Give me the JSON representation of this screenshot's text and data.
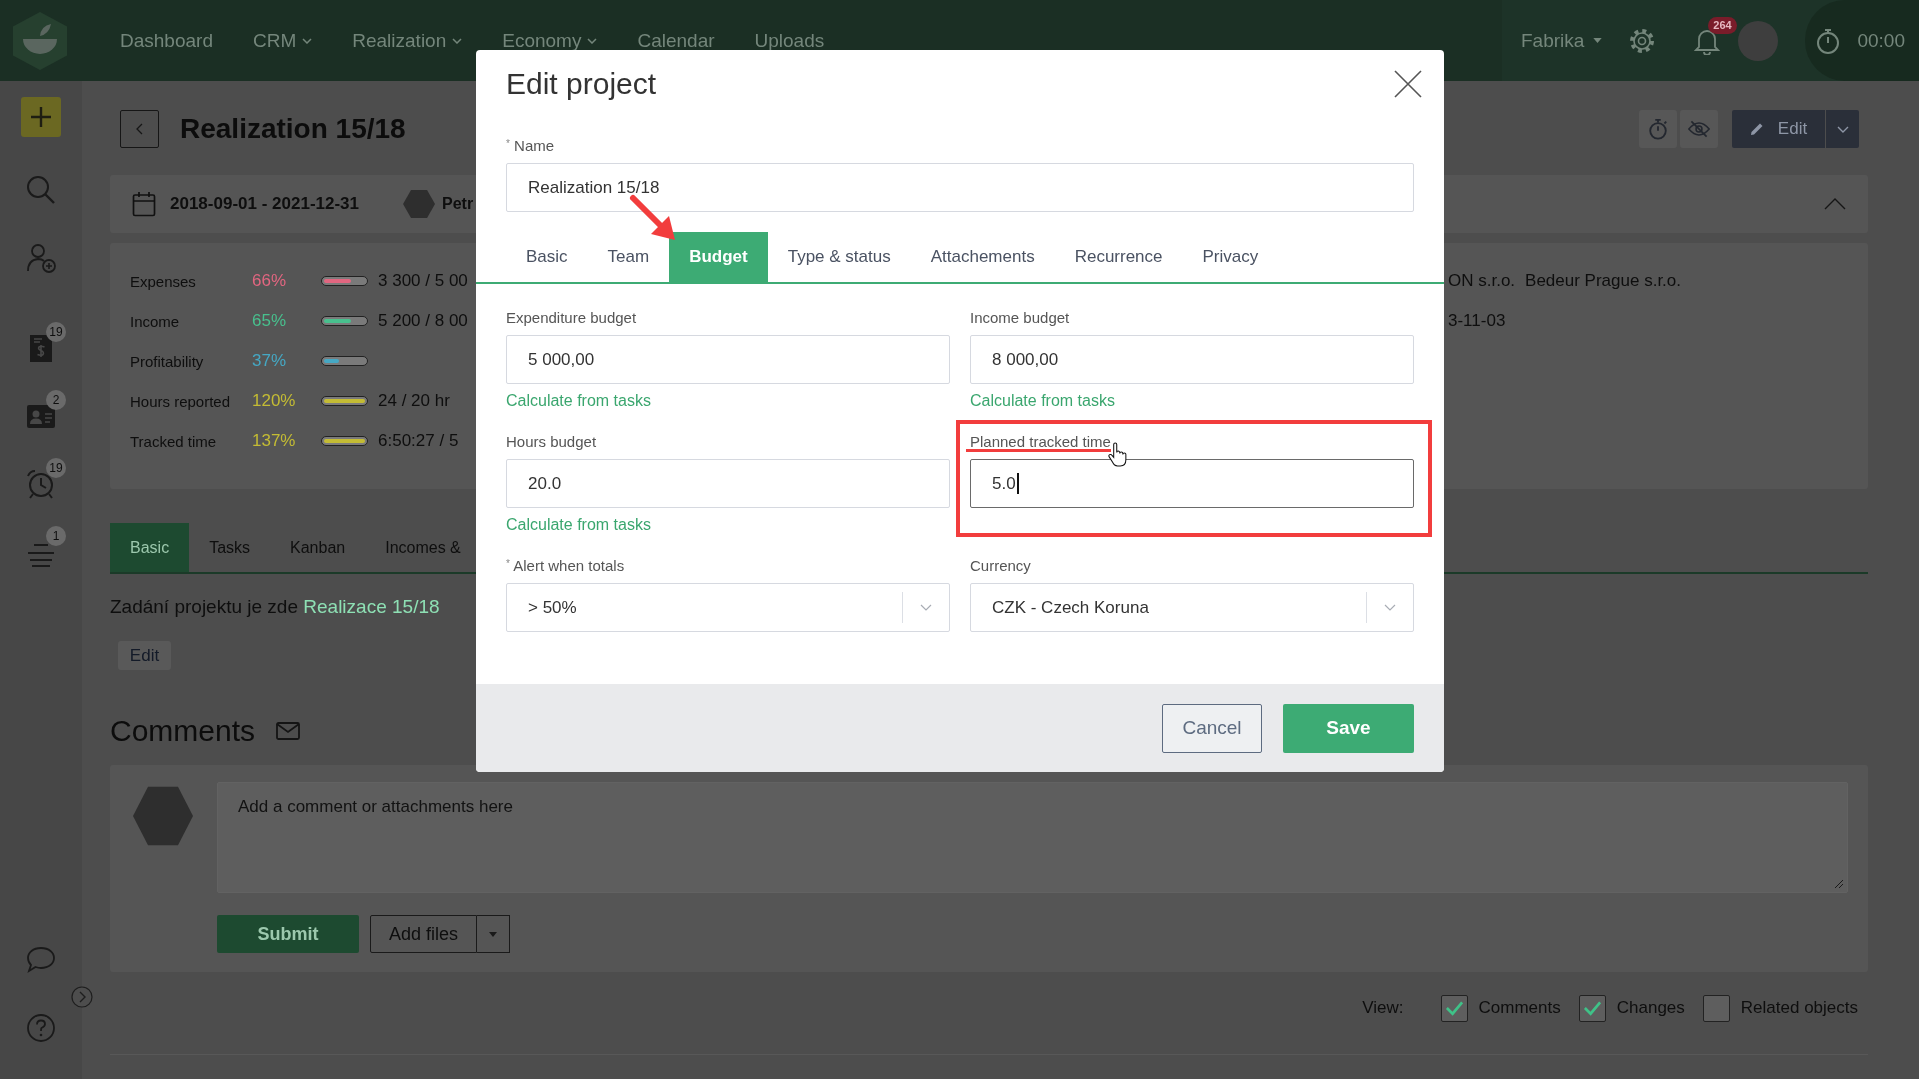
{
  "top_nav": {
    "menu": [
      {
        "label": "Dashboard",
        "dropdown": false
      },
      {
        "label": "CRM",
        "dropdown": true
      },
      {
        "label": "Realization",
        "dropdown": true
      },
      {
        "label": "Economy",
        "dropdown": true
      },
      {
        "label": "Calendar",
        "dropdown": false
      },
      {
        "label": "Uploads",
        "dropdown": false
      }
    ],
    "company": "Fabrika",
    "notification_count": "264",
    "timer": "00:00"
  },
  "sidebar": {
    "items": [
      {
        "kind": "add"
      },
      {
        "kind": "search"
      },
      {
        "kind": "person-add"
      },
      {
        "kind": "invoice",
        "badge": "19"
      },
      {
        "kind": "contact-card",
        "badge": "2"
      },
      {
        "kind": "alarm",
        "badge": "19"
      },
      {
        "kind": "list",
        "badge": "1"
      },
      {
        "kind": "chat"
      },
      {
        "kind": "help"
      }
    ]
  },
  "project": {
    "title": "Realization 15/18",
    "edit_button": "Edit",
    "date_range": "2018-09-01 - 2021-12-31",
    "owner": "Petr",
    "stats": [
      {
        "label": "Expenses",
        "percent": "66%",
        "level": 0.66,
        "color": "#e26680",
        "value": "3 300 / 5 00"
      },
      {
        "label": "Income",
        "percent": "65%",
        "level": 0.65,
        "color": "#48c08e",
        "value": "5 200 / 8 00"
      },
      {
        "label": "Profitability",
        "percent": "37%",
        "level": 0.37,
        "color": "#45a8c4"
      },
      {
        "label": "Hours reported",
        "percent": "120%",
        "level": 1,
        "color": "#c4bc34",
        "value": "24 / 20 hr"
      },
      {
        "label": "Tracked time",
        "percent": "137%",
        "level": 1,
        "color": "#c4bc34",
        "value": "6:50:27 / 5"
      }
    ],
    "clients": [
      "ON s.r.o.",
      "Bedeur Prague s.r.o."
    ],
    "date": "3-11-03",
    "tabs": [
      {
        "label": "Basic",
        "selected": true
      },
      {
        "label": "Tasks",
        "selected": false
      },
      {
        "label": "Kanban",
        "selected": false
      },
      {
        "label": "Incomes &",
        "selected": false
      }
    ],
    "description": {
      "text": "Zadání projektu je zde",
      "link": "Realizace 15/18"
    },
    "description_edit": "Edit"
  },
  "comments": {
    "title": "Comments",
    "placeholder": "Add a comment or attachments here",
    "submit": "Submit",
    "add_files": "Add files",
    "view_label": "View:",
    "view_options": [
      {
        "label": "Comments",
        "checked": true
      },
      {
        "label": "Changes",
        "checked": true
      },
      {
        "label": "Related objects",
        "checked": false
      }
    ]
  },
  "modal": {
    "title": "Edit project",
    "name_field": {
      "label": "$^{*}$ Name",
      "value": "Realization 15/18"
    },
    "tabs": [
      {
        "label": "Basic",
        "selected": false
      },
      {
        "label": "Team",
        "selected": false
      },
      {
        "label": "Budget",
        "selected": true
      },
      {
        "label": "Type & status",
        "selected": false
      },
      {
        "label": "Attachements",
        "selected": false
      },
      {
        "label": "Recurrence",
        "selected": false
      },
      {
        "label": "Privacy",
        "selected": false
      }
    ],
    "fields": [
      {
        "kind": "input",
        "label": "Expenditure budget",
        "value": "5 000,00",
        "link": "Calculate from tasks",
        "focused": false,
        "highlighted": false
      },
      {
        "kind": "input",
        "label": "Income budget",
        "value": "8 000,00",
        "link": "Calculate from tasks",
        "focused": false,
        "highlighted": false
      },
      {
        "kind": "input",
        "label": "Hours budget",
        "value": "20.0",
        "link": "Calculate from tasks",
        "focused": false,
        "highlighted": false
      },
      {
        "kind": "input",
        "label": "Planned tracked time",
        "value": "5.0",
        "focused": true,
        "highlighted": true
      },
      {
        "kind": "select",
        "label": "$^{*}$ Alert when totals",
        "value": "> 50%",
        "focused": false,
        "highlighted": false
      },
      {
        "kind": "select",
        "label": "Currency",
        "value": "CZK - Czech Koruna",
        "focused": false,
        "highlighted": false
      }
    ],
    "cancel": "Cancel",
    "save": "Save"
  }
}
